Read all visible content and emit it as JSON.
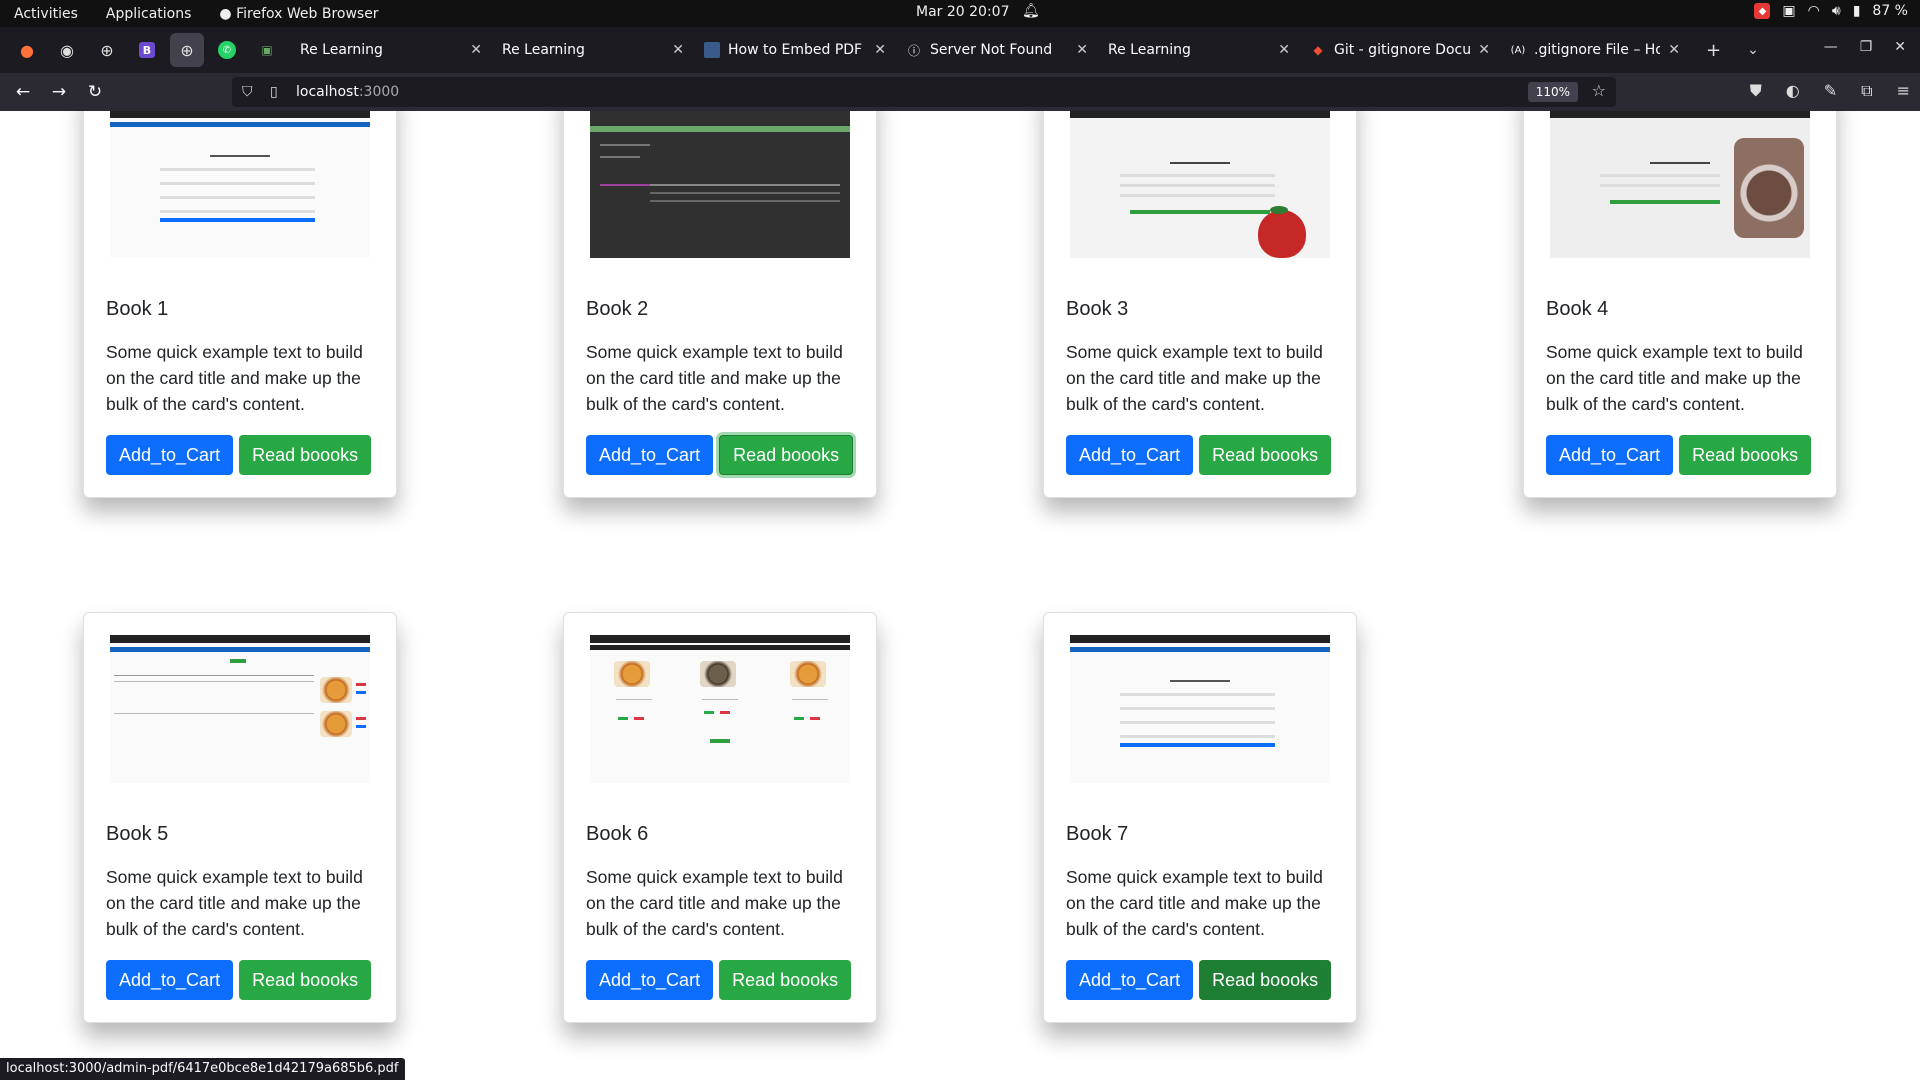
{
  "system": {
    "activities": "Activities",
    "applications": "Applications",
    "app_name": "Firefox Web Browser",
    "clock": "Mar 20  20:07",
    "battery": "87 %"
  },
  "browser": {
    "tabs": [
      {
        "title": "Re Learning",
        "icon": "globe-icon"
      },
      {
        "title": "Re Learning",
        "icon": "globe-icon"
      },
      {
        "title": "How to Embed PDF in",
        "icon": "site-icon"
      },
      {
        "title": "Server Not Found",
        "icon": "info-icon"
      },
      {
        "title": "Re Learning",
        "icon": "globe-icon"
      },
      {
        "title": "Git - gitignore Docum",
        "icon": "git-icon"
      },
      {
        "title": ".gitignore File – How",
        "icon": "site-icon"
      }
    ],
    "url_host": "localhost",
    "url_port": ":3000",
    "zoom": "110%",
    "status_url": "localhost:3000/admin-pdf/6417e0bce8e1d42179a685b6.pdf"
  },
  "cards": [
    {
      "title": "Book 1",
      "text": "Some quick example text to build on the card title and make up the bulk of the card's content.",
      "add_label": "Add_to_Cart",
      "read_label": "Read boooks"
    },
    {
      "title": "Book 2",
      "text": "Some quick example text to build on the card title and make up the bulk of the card's content.",
      "add_label": "Add_to_Cart",
      "read_label": "Read boooks"
    },
    {
      "title": "Book 3",
      "text": "Some quick example text to build on the card title and make up the bulk of the card's content.",
      "add_label": "Add_to_Cart",
      "read_label": "Read boooks"
    },
    {
      "title": "Book 4",
      "text": "Some quick example text to build on the card title and make up the bulk of the card's content.",
      "add_label": "Add_to_Cart",
      "read_label": "Read boooks"
    },
    {
      "title": "Book 5",
      "text": "Some quick example text to build on the card title and make up the bulk of the card's content.",
      "add_label": "Add_to_Cart",
      "read_label": "Read boooks"
    },
    {
      "title": "Book 6",
      "text": "Some quick example text to build on the card title and make up the bulk of the card's content.",
      "add_label": "Add_to_Cart",
      "read_label": "Read boooks"
    },
    {
      "title": "Book 7",
      "text": "Some quick example text to build on the card title and make up the bulk of the card's content.",
      "add_label": "Add_to_Cart",
      "read_label": "Read boooks"
    }
  ],
  "colors": {
    "primary": "#0d6efd",
    "success": "#28a745",
    "success_active": "#1e7e34",
    "tab_strip": "#1c1b22",
    "nav_bar": "#2b2a33"
  }
}
